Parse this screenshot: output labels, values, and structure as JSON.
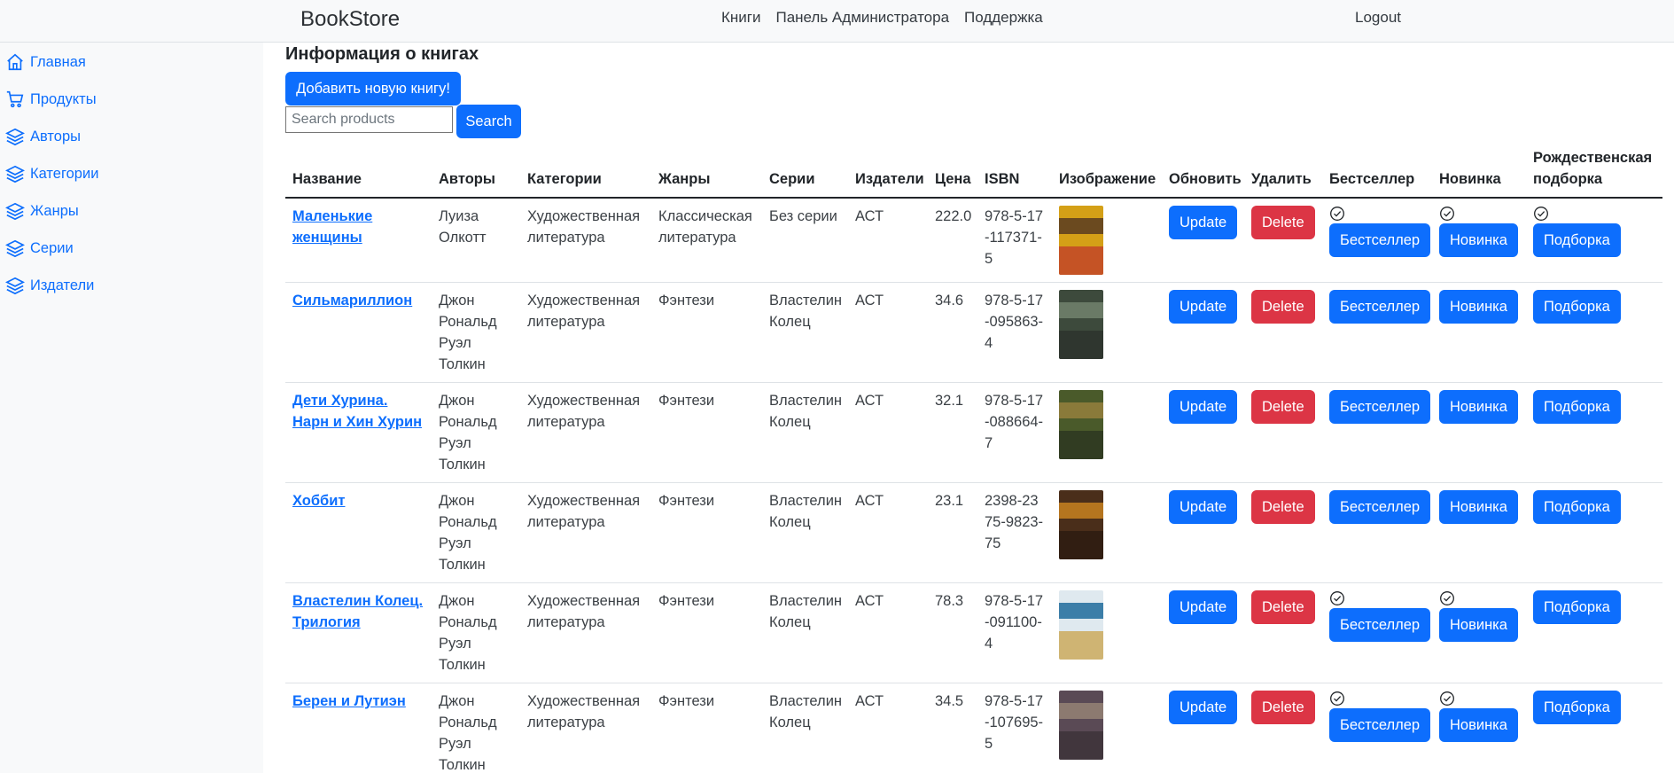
{
  "navbar": {
    "brand": "BookStore",
    "links": [
      "Книги",
      "Панель Администратора",
      "Поддержка"
    ],
    "logout": "Logout"
  },
  "sidebar": {
    "items": [
      {
        "label": "Главная",
        "icon": "home-icon"
      },
      {
        "label": "Продукты",
        "icon": "cart-icon"
      },
      {
        "label": "Авторы",
        "icon": "layers-icon"
      },
      {
        "label": "Категории",
        "icon": "layers-icon"
      },
      {
        "label": "Жанры",
        "icon": "layers-icon"
      },
      {
        "label": "Серии",
        "icon": "layers-icon"
      },
      {
        "label": "Издатели",
        "icon": "layers-icon"
      }
    ]
  },
  "main": {
    "title": "Информация о книгах",
    "add_button": "Добавить новую книгу!",
    "search_placeholder": "Search products",
    "search_button": "Search"
  },
  "table": {
    "headers": [
      "Название",
      "Авторы",
      "Категории",
      "Жанры",
      "Серии",
      "Издатели",
      "Цена",
      "ISBN",
      "Изображение",
      "Обновить",
      "Удалить",
      "Бестселлер",
      "Новинка",
      "Рождественская подборка"
    ],
    "buttons": {
      "update": "Update",
      "delete": "Delete",
      "bestseller": "Бестселлер",
      "new": "Новинка",
      "collection": "Подборка"
    },
    "rows": [
      {
        "name": "Маленькие женщины",
        "author": "Луиза Олкотт",
        "category": "Художественная литература",
        "genre": "Классическая литература",
        "series": "Без серии",
        "publisher": "АСТ",
        "price": "222.0",
        "isbn": "978-5-17-117371-5",
        "bestseller": true,
        "new": true,
        "collection": true,
        "cover_colors": [
          "#d4a017",
          "#6b4a1f",
          "#c0392b"
        ]
      },
      {
        "name": "Сильмариллион",
        "author": "Джон Рональд Руэл Толкин",
        "category": "Художественная литература",
        "genre": "Фэнтези",
        "series": "Властелин Колец",
        "publisher": "АСТ",
        "price": "34.6",
        "isbn": "978-5-17-095863-4",
        "bestseller": false,
        "new": false,
        "collection": false,
        "cover_colors": [
          "#3d4a3c",
          "#6a7a66",
          "#2b302b"
        ]
      },
      {
        "name": "Дети Хурина. Нарн и Хин Хурин",
        "author": "Джон Рональд Руэл Толкин",
        "category": "Художественная литература",
        "genre": "Фэнтези",
        "series": "Властелин Колец",
        "publisher": "АСТ",
        "price": "32.1",
        "isbn": "978-5-17-088664-7",
        "bestseller": false,
        "new": false,
        "collection": false,
        "cover_colors": [
          "#4a5a2a",
          "#8a7a3a",
          "#2a3320"
        ]
      },
      {
        "name": "Хоббит",
        "author": "Джон Рональд Руэл Толкин",
        "category": "Художественная литература",
        "genre": "Фэнтези",
        "series": "Властелин Колец",
        "publisher": "АСТ",
        "price": "23.1",
        "isbn": "2398-2375-9823-75",
        "bestseller": false,
        "new": false,
        "collection": false,
        "cover_colors": [
          "#4a2e1a",
          "#b5751f",
          "#2a1a10"
        ]
      },
      {
        "name": "Властелин Колец. Трилогия",
        "author": "Джон Рональд Руэл Толкин",
        "category": "Художественная литература",
        "genre": "Фэнтези",
        "series": "Властелин Колец",
        "publisher": "АСТ",
        "price": "78.3",
        "isbn": "978-5-17-091100-4",
        "bestseller": true,
        "new": true,
        "collection": false,
        "cover_colors": [
          "#dfe9ef",
          "#3c7ea8",
          "#c9a24a"
        ]
      },
      {
        "name": "Берен и Лутиэн",
        "author": "Джон Рональд Руэл Толкин",
        "category": "Художественная литература",
        "genre": "Фэнтези",
        "series": "Властелин Колец",
        "publisher": "АСТ",
        "price": "34.5",
        "isbn": "978-5-17-107695-5",
        "bestseller": true,
        "new": true,
        "collection": false,
        "cover_colors": [
          "#5a4a55",
          "#8c7a70",
          "#3a3035"
        ]
      }
    ]
  }
}
